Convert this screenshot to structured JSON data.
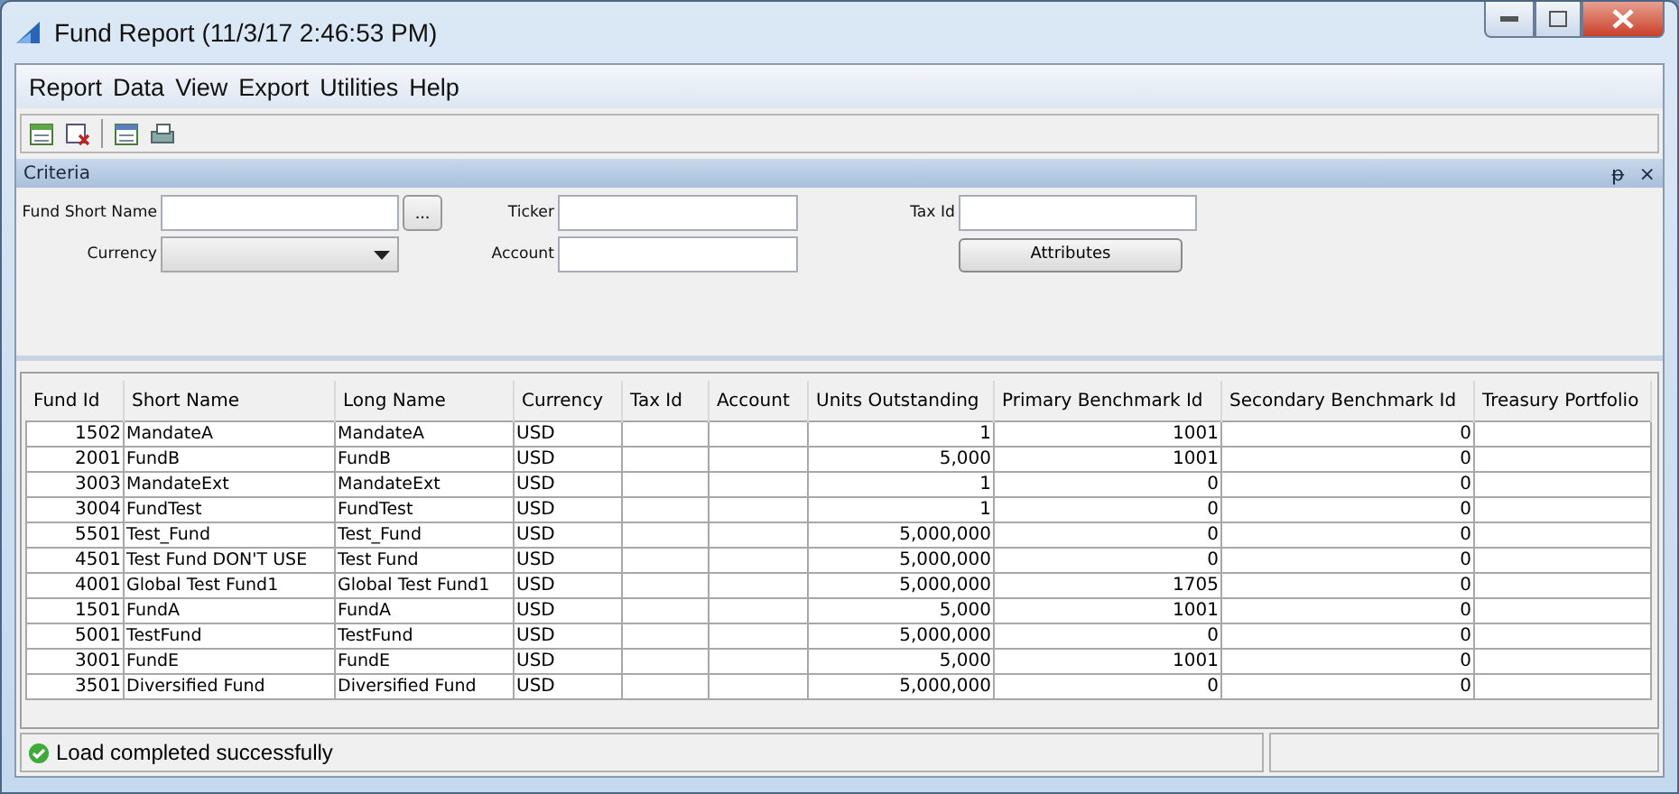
{
  "window": {
    "title": "Fund Report (11/3/17 2:46:53 PM)"
  },
  "menu": [
    "Report",
    "Data",
    "View",
    "Export",
    "Utilities",
    "Help"
  ],
  "criteria": {
    "title": "Criteria",
    "pin": "ᵽ",
    "close": "×",
    "fields": [
      {
        "label": "Fund Short Name",
        "kind": "text"
      },
      {
        "label": "Ticker",
        "kind": "text"
      },
      {
        "label": "Tax Id",
        "kind": "text"
      },
      {
        "label": "Currency",
        "kind": "dropdown"
      },
      {
        "label": "Account",
        "kind": "text"
      }
    ],
    "browse_button": "...",
    "attributes_button": "Attributes"
  },
  "table": {
    "columns": [
      "Fund Id",
      "Short Name",
      "Long Name",
      "Currency",
      "Tax Id",
      "Account",
      "Units Outstanding",
      "Primary Benchmark Id",
      "Secondary Benchmark Id",
      "Treasury Portfolio"
    ],
    "rows": [
      [
        "1502",
        "MandateA",
        "MandateA",
        "USD",
        "",
        "",
        "1",
        "1001",
        "0",
        ""
      ],
      [
        "2001",
        "FundB",
        "FundB",
        "USD",
        "",
        "",
        "5,000",
        "1001",
        "0",
        ""
      ],
      [
        "3003",
        "MandateExt",
        "MandateExt",
        "USD",
        "",
        "",
        "1",
        "0",
        "0",
        ""
      ],
      [
        "3004",
        "FundTest",
        "FundTest",
        "USD",
        "",
        "",
        "1",
        "0",
        "0",
        ""
      ],
      [
        "5501",
        "Test_Fund",
        "Test_Fund",
        "USD",
        "",
        "",
        "5,000,000",
        "0",
        "0",
        ""
      ],
      [
        "4501",
        "Test Fund DON'T USE",
        "Test Fund",
        "USD",
        "",
        "",
        "5,000,000",
        "0",
        "0",
        ""
      ],
      [
        "4001",
        "Global Test Fund1",
        "Global Test Fund1",
        "USD",
        "",
        "",
        "5,000,000",
        "1705",
        "0",
        ""
      ],
      [
        "1501",
        "FundA",
        "FundA",
        "USD",
        "",
        "",
        "5,000",
        "1001",
        "0",
        ""
      ],
      [
        "5001",
        "TestFund",
        "TestFund",
        "USD",
        "",
        "",
        "5,000,000",
        "0",
        "0",
        ""
      ],
      [
        "3001",
        "FundE",
        "FundE",
        "USD",
        "",
        "",
        "5,000",
        "1001",
        "0",
        ""
      ],
      [
        "3501",
        "Diversified Fund",
        "Diversified Fund",
        "USD",
        "",
        "",
        "5,000,000",
        "0",
        "0",
        ""
      ]
    ]
  },
  "status_bar": {
    "message": "Load completed successfully"
  }
}
